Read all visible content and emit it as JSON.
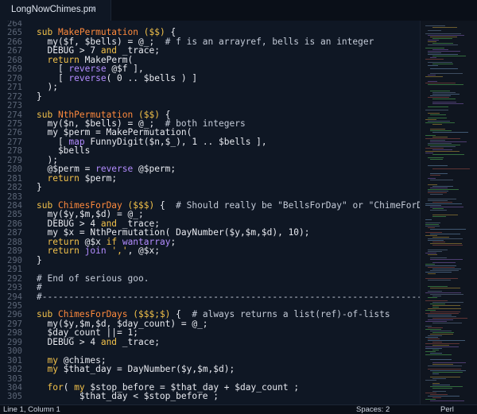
{
  "tab": {
    "title": "LongNowChimes.pm",
    "close_glyph": "✕"
  },
  "status": {
    "position": "Line 1, Column 1",
    "indent": "Spaces: 2",
    "language": "Perl"
  },
  "colors": {
    "keyword": "#f2c14a",
    "function": "#ff8a3d",
    "comment": "#c4cbd8",
    "builtin": "#b38cff",
    "background": "#0f1724"
  },
  "lines": [
    {
      "num": "264",
      "tokens": []
    },
    {
      "num": "265",
      "tokens": [
        [
          "kw",
          "sub "
        ],
        [
          "fn",
          "MakePermutation"
        ],
        [
          "vr",
          " "
        ],
        [
          "kw",
          "($$)"
        ],
        [
          "vr",
          " {"
        ]
      ]
    },
    {
      "num": "266",
      "tokens": [
        [
          "vr",
          "  my($f, $bells) = @_;  "
        ],
        [
          "cm",
          "# f is an arrayref, bells is an integer"
        ]
      ]
    },
    {
      "num": "267",
      "tokens": [
        [
          "vr",
          "  DEBUG > 7 "
        ],
        [
          "kw",
          "and"
        ],
        [
          "vr",
          " _trace;"
        ]
      ]
    },
    {
      "num": "268",
      "tokens": [
        [
          "vr",
          "  "
        ],
        [
          "kw",
          "return"
        ],
        [
          "vr",
          " MakePerm("
        ]
      ]
    },
    {
      "num": "269",
      "tokens": [
        [
          "vr",
          "    [ "
        ],
        [
          "bi",
          "reverse"
        ],
        [
          "vr",
          " @$f ],"
        ]
      ]
    },
    {
      "num": "270",
      "tokens": [
        [
          "vr",
          "    [ "
        ],
        [
          "bi",
          "reverse"
        ],
        [
          "vr",
          "( 0 .. $bells ) ]"
        ]
      ]
    },
    {
      "num": "271",
      "tokens": [
        [
          "vr",
          "  );"
        ]
      ]
    },
    {
      "num": "272",
      "tokens": [
        [
          "vr",
          "}"
        ]
      ]
    },
    {
      "num": "273",
      "tokens": []
    },
    {
      "num": "274",
      "tokens": [
        [
          "kw",
          "sub "
        ],
        [
          "fn",
          "NthPermutation"
        ],
        [
          "vr",
          " "
        ],
        [
          "kw",
          "($$)"
        ],
        [
          "vr",
          " {"
        ]
      ]
    },
    {
      "num": "275",
      "tokens": [
        [
          "vr",
          "  my($n, $bells) = @_;  "
        ],
        [
          "cm",
          "# both integers"
        ]
      ]
    },
    {
      "num": "276",
      "tokens": [
        [
          "vr",
          "  my $perm = MakePermutation("
        ]
      ]
    },
    {
      "num": "277",
      "tokens": [
        [
          "vr",
          "    [ "
        ],
        [
          "bi",
          "map"
        ],
        [
          "vr",
          " FunnyDigit($n,$_), 1 .. $bells ],"
        ]
      ]
    },
    {
      "num": "278",
      "tokens": [
        [
          "vr",
          "    $bells"
        ]
      ]
    },
    {
      "num": "279",
      "tokens": [
        [
          "vr",
          "  );"
        ]
      ]
    },
    {
      "num": "280",
      "tokens": [
        [
          "vr",
          "  @$perm = "
        ],
        [
          "bi",
          "reverse"
        ],
        [
          "vr",
          " @$perm;"
        ]
      ]
    },
    {
      "num": "281",
      "tokens": [
        [
          "vr",
          "  "
        ],
        [
          "kw",
          "return"
        ],
        [
          "vr",
          " $perm;"
        ]
      ]
    },
    {
      "num": "282",
      "tokens": [
        [
          "vr",
          "}"
        ]
      ]
    },
    {
      "num": "283",
      "tokens": []
    },
    {
      "num": "284",
      "tokens": [
        [
          "kw",
          "sub "
        ],
        [
          "fn",
          "ChimesForDay"
        ],
        [
          "vr",
          " "
        ],
        [
          "kw",
          "($$$)"
        ],
        [
          "vr",
          " {  "
        ],
        [
          "cm",
          "# Should really be \"BellsForDay\" or \"ChimeForDay\""
        ]
      ]
    },
    {
      "num": "285",
      "tokens": [
        [
          "vr",
          "  my($y,$m,$d) = @_;"
        ]
      ]
    },
    {
      "num": "286",
      "tokens": [
        [
          "vr",
          "  DEBUG > 4 "
        ],
        [
          "kw",
          "and"
        ],
        [
          "vr",
          " _trace;"
        ]
      ]
    },
    {
      "num": "287",
      "tokens": [
        [
          "vr",
          "  my $x = NthPermutation( DayNumber($y,$m,$d), 10);"
        ]
      ]
    },
    {
      "num": "288",
      "tokens": [
        [
          "vr",
          "  "
        ],
        [
          "kw",
          "return"
        ],
        [
          "vr",
          " @$x "
        ],
        [
          "kw",
          "if"
        ],
        [
          "vr",
          " "
        ],
        [
          "bi",
          "wantarray"
        ],
        [
          "vr",
          ";"
        ]
      ]
    },
    {
      "num": "289",
      "tokens": [
        [
          "vr",
          "  "
        ],
        [
          "kw",
          "return"
        ],
        [
          "vr",
          " "
        ],
        [
          "bi",
          "join"
        ],
        [
          "vr",
          " "
        ],
        [
          "str",
          "','"
        ],
        [
          "vr",
          ", @$x;"
        ]
      ]
    },
    {
      "num": "290",
      "tokens": [
        [
          "vr",
          "}"
        ]
      ]
    },
    {
      "num": "291",
      "tokens": []
    },
    {
      "num": "292",
      "tokens": [
        [
          "cm",
          "# End of serious goo."
        ]
      ]
    },
    {
      "num": "293",
      "tokens": [
        [
          "cm",
          "#"
        ]
      ]
    },
    {
      "num": "294",
      "tokens": [
        [
          "cm",
          "#-------------------------------------------------------------------------"
        ]
      ]
    },
    {
      "num": "295",
      "tokens": []
    },
    {
      "num": "296",
      "tokens": [
        [
          "kw",
          "sub "
        ],
        [
          "fn",
          "ChimesForDays"
        ],
        [
          "vr",
          " "
        ],
        [
          "kw",
          "($$$;$)"
        ],
        [
          "vr",
          " {  "
        ],
        [
          "cm",
          "# always returns a list(ref)-of-lists"
        ]
      ]
    },
    {
      "num": "297",
      "tokens": [
        [
          "vr",
          "  my($y,$m,$d, $day_count) = @_;"
        ]
      ]
    },
    {
      "num": "298",
      "tokens": [
        [
          "vr",
          "  $day_count ||= 1;"
        ]
      ]
    },
    {
      "num": "299",
      "tokens": [
        [
          "vr",
          "  DEBUG > 4 "
        ],
        [
          "kw",
          "and"
        ],
        [
          "vr",
          " _trace;"
        ]
      ]
    },
    {
      "num": "300",
      "tokens": []
    },
    {
      "num": "301",
      "tokens": [
        [
          "vr",
          "  "
        ],
        [
          "kw",
          "my"
        ],
        [
          "vr",
          " @chimes;"
        ]
      ]
    },
    {
      "num": "302",
      "tokens": [
        [
          "vr",
          "  "
        ],
        [
          "kw",
          "my"
        ],
        [
          "vr",
          " $that_day = DayNumber($y,$m,$d);"
        ]
      ]
    },
    {
      "num": "303",
      "tokens": []
    },
    {
      "num": "304",
      "tokens": [
        [
          "vr",
          "  "
        ],
        [
          "kw",
          "for"
        ],
        [
          "vr",
          "( "
        ],
        [
          "kw",
          "my"
        ],
        [
          "vr",
          " $stop_before = $that_day + $day_count ;"
        ]
      ]
    },
    {
      "num": "305",
      "tokens": [
        [
          "vr",
          "        $that_day < $stop_before ;"
        ]
      ]
    }
  ]
}
